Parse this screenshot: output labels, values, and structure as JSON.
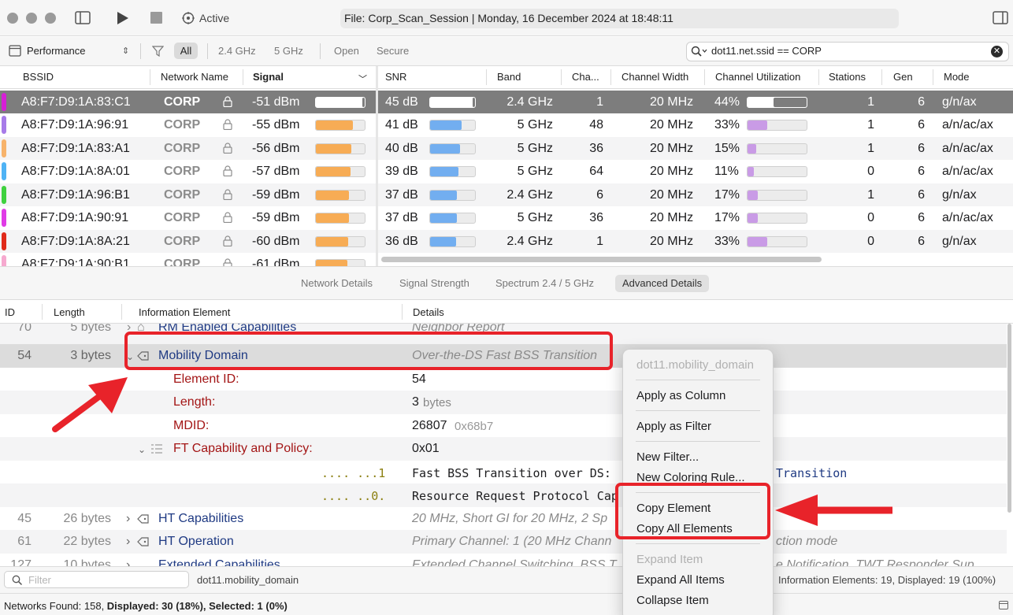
{
  "toolbar": {
    "status_label": "Active",
    "window_title": "File: Corp_Scan_Session | Monday, 16 December 2024 at 18:48:11",
    "icons": [
      "sidebar-toggle-icon",
      "play-icon",
      "stop-icon",
      "target-icon",
      "sidebar-right-icon"
    ]
  },
  "filterbar": {
    "view_selector": "Performance",
    "chips": [
      "All",
      "2.4 GHz",
      "5 GHz",
      "Open",
      "Secure"
    ],
    "search_value": "dot11.net.ssid == CORP"
  },
  "networks": {
    "columns": [
      "BSSID",
      "Network Name",
      "Signal",
      "SNR",
      "Band",
      "Cha...",
      "Channel Width",
      "Channel Utilization",
      "Stations",
      "Gen",
      "Mode"
    ],
    "rows": [
      {
        "bssid": "A8:F7:D9:1A:83:C1",
        "ssid": "CORP",
        "signal": "-51 dBm",
        "signal_pct": 95,
        "snr": "45 dB",
        "snr_pct": 95,
        "band": "2.4 GHz",
        "channel": "1",
        "width": "20 MHz",
        "util": "44%",
        "util_pct": 44,
        "stations": "1",
        "gen": "6",
        "mode": "g/n/ax",
        "color": "#d61fd6",
        "selected": true
      },
      {
        "bssid": "A8:F7:D9:1A:96:91",
        "ssid": "CORP",
        "signal": "-55 dBm",
        "signal_pct": 75,
        "snr": "41 dB",
        "snr_pct": 70,
        "band": "5 GHz",
        "channel": "48",
        "width": "20 MHz",
        "util": "33%",
        "util_pct": 33,
        "stations": "1",
        "gen": "6",
        "mode": "a/n/ac/ax",
        "color": "#a77be8"
      },
      {
        "bssid": "A8:F7:D9:1A:83:A1",
        "ssid": "CORP",
        "signal": "-56 dBm",
        "signal_pct": 73,
        "snr": "40 dB",
        "snr_pct": 66,
        "band": "5 GHz",
        "channel": "36",
        "width": "20 MHz",
        "util": "15%",
        "util_pct": 15,
        "stations": "1",
        "gen": "6",
        "mode": "a/n/ac/ax",
        "color": "#f7b36b"
      },
      {
        "bssid": "A8:F7:D9:1A:8A:01",
        "ssid": "CORP",
        "signal": "-57 dBm",
        "signal_pct": 71,
        "snr": "39 dB",
        "snr_pct": 64,
        "band": "5 GHz",
        "channel": "64",
        "width": "20 MHz",
        "util": "11%",
        "util_pct": 11,
        "stations": "0",
        "gen": "6",
        "mode": "a/n/ac/ax",
        "color": "#4fb3f5"
      },
      {
        "bssid": "A8:F7:D9:1A:96:B1",
        "ssid": "CORP",
        "signal": "-59 dBm",
        "signal_pct": 68,
        "snr": "37 dB",
        "snr_pct": 60,
        "band": "2.4 GHz",
        "channel": "6",
        "width": "20 MHz",
        "util": "17%",
        "util_pct": 17,
        "stations": "1",
        "gen": "6",
        "mode": "g/n/ax",
        "color": "#3fd13f"
      },
      {
        "bssid": "A8:F7:D9:1A:90:91",
        "ssid": "CORP",
        "signal": "-59 dBm",
        "signal_pct": 68,
        "snr": "37 dB",
        "snr_pct": 60,
        "band": "5 GHz",
        "channel": "36",
        "width": "20 MHz",
        "util": "17%",
        "util_pct": 17,
        "stations": "0",
        "gen": "6",
        "mode": "a/n/ac/ax",
        "color": "#e03be6"
      },
      {
        "bssid": "A8:F7:D9:1A:8A:21",
        "ssid": "CORP",
        "signal": "-60 dBm",
        "signal_pct": 66,
        "snr": "36 dB",
        "snr_pct": 58,
        "band": "2.4 GHz",
        "channel": "1",
        "width": "20 MHz",
        "util": "33%",
        "util_pct": 33,
        "stations": "0",
        "gen": "6",
        "mode": "g/n/ax",
        "color": "#e02a1a"
      },
      {
        "bssid": "A8:F7:D9:1A:90:B1",
        "ssid": "CORP",
        "signal": "-61 dBm",
        "signal_pct": 64,
        "snr": "",
        "snr_pct": 0,
        "band": "",
        "channel": "",
        "width": "",
        "util": "",
        "util_pct": 0,
        "stations": "",
        "gen": "",
        "mode": "",
        "color": "#f6a9cf"
      }
    ]
  },
  "tabs": [
    "Network Details",
    "Signal Strength",
    "Spectrum 2.4 / 5 GHz",
    "Advanced Details"
  ],
  "active_tab": "Advanced Details",
  "details": {
    "columns": [
      "ID",
      "Length",
      "Information Element",
      "Details"
    ],
    "rows": [
      {
        "id": "70",
        "length": "5 bytes",
        "name": "RM Enabled Capabilities",
        "detail": "Neighbor Report"
      },
      {
        "id": "54",
        "length": "3 bytes",
        "name": "Mobility Domain",
        "detail": "Over-the-DS Fast BSS Transition"
      },
      {
        "sub_label": "Element ID:",
        "value": "54"
      },
      {
        "sub_label": "Length:",
        "value": "3",
        "unit": "bytes"
      },
      {
        "sub_label": "MDID:",
        "value": "26807",
        "hex": "0x68b7"
      },
      {
        "sub_label": "FT Capability and Policy:",
        "value": "0x01"
      },
      {
        "bits": ".... ...1",
        "text": "Fast BSS Transition over DS:",
        "suffix": "Transition"
      },
      {
        "bits": ".... ..0.",
        "text": "Resource Request Protocol Cap"
      },
      {
        "id": "45",
        "length": "26 bytes",
        "name": "HT Capabilities",
        "detail": "20 MHz, Short GI for 20 MHz, 2 Sp"
      },
      {
        "id": "61",
        "length": "22 bytes",
        "name": "HT Operation",
        "detail": "Primary Channel: 1 (20 MHz Chann",
        "detail_tail": "ction mode"
      },
      {
        "id": "127",
        "length": "10 bytes",
        "name": "Extended Capabilities",
        "detail": "Extended Channel Switching, BSS T",
        "detail_tail": "e Notification, TWT Responder Sup"
      }
    ]
  },
  "bottombar": {
    "filter_placeholder": "Filter",
    "path": "dot11.mobility_domain",
    "summary": "Information Elements: 19, Displayed: 19 (100%)"
  },
  "status": {
    "found": "Networks Found: 158, ",
    "displayed": "Displayed: 30 (18%), Selected: 1 (0%)"
  },
  "context_menu": {
    "header": "dot11.mobility_domain",
    "items": [
      "Apply as Column",
      "Apply as Filter",
      "New Filter...",
      "New Coloring Rule...",
      "Copy Element",
      "Copy All Elements",
      "Expand Item",
      "Expand All Items",
      "Collapse Item"
    ]
  }
}
